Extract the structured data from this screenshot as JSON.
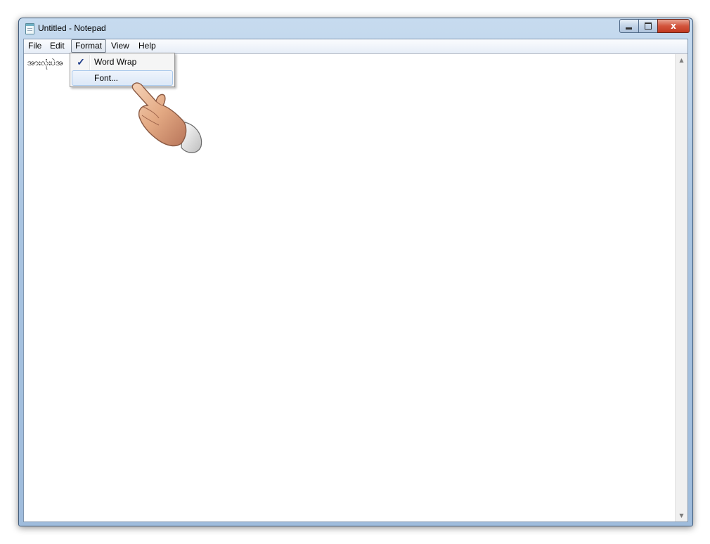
{
  "window": {
    "title": "Untitled - Notepad",
    "controls": {
      "minimize": "",
      "maximize": "",
      "close": "x"
    }
  },
  "menubar": {
    "items": [
      {
        "id": "file",
        "label": "File"
      },
      {
        "id": "edit",
        "label": "Edit"
      },
      {
        "id": "format",
        "label": "Format",
        "active": true
      },
      {
        "id": "view",
        "label": "View"
      },
      {
        "id": "help",
        "label": "Help"
      }
    ]
  },
  "format_menu": {
    "items": [
      {
        "label": "Word Wrap",
        "checked": true,
        "check_mark": "✓"
      },
      {
        "label": "Font...",
        "checked": false,
        "highlighted": true
      }
    ]
  },
  "editor": {
    "text": "အားလုံးပဲအ"
  },
  "scrollbar": {
    "up_arrow": "▲",
    "down_arrow": "▼"
  },
  "colors": {
    "title_bar": "#a9c4e1",
    "close_button": "#d2543c",
    "menu_highlight": "#dce8f7",
    "check_mark": "#1c3a88"
  },
  "icons": [
    "notepad-icon",
    "minimize-icon",
    "maximize-icon",
    "close-icon",
    "checkmark-icon",
    "pointing-hand-cursor-icon"
  ]
}
